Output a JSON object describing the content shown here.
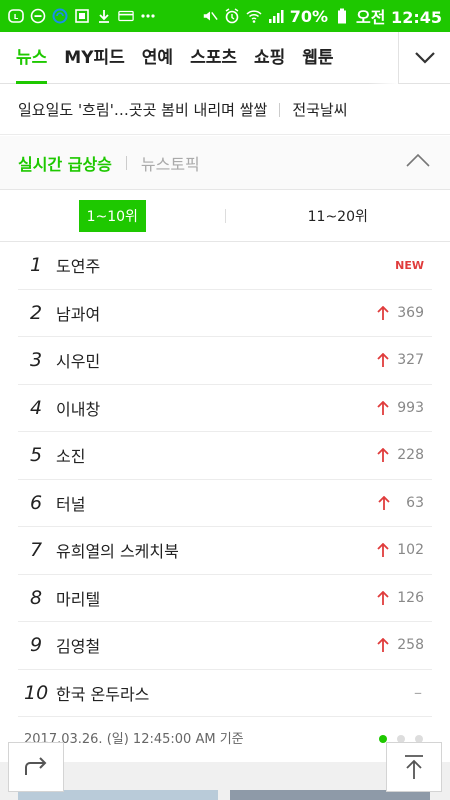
{
  "status_bar": {
    "battery_percent": "70%",
    "time": "오전 12:45",
    "background_color": "#1ec800",
    "icons_left": [
      "line-icon",
      "dnd-icon",
      "sync-icon",
      "ohsio-icon",
      "download-icon",
      "card-icon",
      "dots-icon"
    ],
    "icons_right": [
      "mute-icon",
      "alarm-icon",
      "wifi-icon",
      "signal-icon",
      "battery-icon"
    ]
  },
  "nav": {
    "tabs": [
      {
        "label": "뉴스",
        "active": true
      },
      {
        "label": "MY피드",
        "active": false
      },
      {
        "label": "연예",
        "active": false
      },
      {
        "label": "스포츠",
        "active": false
      },
      {
        "label": "쇼핑",
        "active": false
      },
      {
        "label": "웹툰",
        "active": false
      }
    ],
    "more_icon": "chevron-down-icon"
  },
  "headline": {
    "text": "일요일도 '흐림'…곳곳 봄비 내리며 쌀쌀",
    "weather_link": "전국날씨"
  },
  "realtime": {
    "title": "실시간 급상승",
    "topic_tab": "뉴스토픽",
    "collapse_icon": "chevron-up-icon"
  },
  "range_tabs": [
    {
      "label": "1~10위",
      "active": true
    },
    {
      "label": "11~20위",
      "active": false
    }
  ],
  "ranking": [
    {
      "rank": "1",
      "term": "도연주",
      "change": "NEW",
      "type": "new"
    },
    {
      "rank": "2",
      "term": "남과여",
      "change": "369",
      "type": "up"
    },
    {
      "rank": "3",
      "term": "시우민",
      "change": "327",
      "type": "up"
    },
    {
      "rank": "4",
      "term": "이내창",
      "change": "993",
      "type": "up"
    },
    {
      "rank": "5",
      "term": "소진",
      "change": "228",
      "type": "up"
    },
    {
      "rank": "6",
      "term": "터널",
      "change": "63",
      "type": "up"
    },
    {
      "rank": "7",
      "term": "유희열의 스케치북",
      "change": "102",
      "type": "up"
    },
    {
      "rank": "8",
      "term": "마리텔",
      "change": "126",
      "type": "up"
    },
    {
      "rank": "9",
      "term": "김영철",
      "change": "258",
      "type": "up"
    },
    {
      "rank": "10",
      "term": "한국 온두라스",
      "change": "–",
      "type": "same"
    }
  ],
  "timestamp": "2017.03.26. (일) 12:45:00 AM 기준",
  "pager": {
    "count": 3,
    "active_index": 0
  },
  "buttons": {
    "share_icon": "share-icon",
    "top_icon": "scroll-top-icon"
  },
  "colors": {
    "accent": "#1ec800",
    "up_arrow": "#e03c3c",
    "new_badge": "#e03c3c"
  }
}
